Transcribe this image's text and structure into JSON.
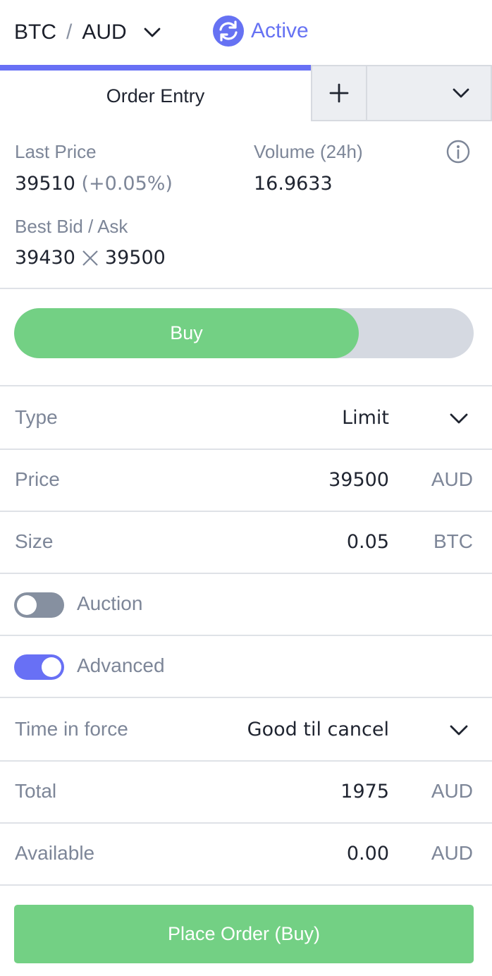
{
  "header": {
    "base": "BTC",
    "separator": "/",
    "quote": "AUD",
    "status": "Active",
    "icons": {
      "pair_dropdown": "chevron-down-icon",
      "status": "sync-icon"
    }
  },
  "tabs": {
    "active_label": "Order Entry",
    "add_icon": "plus-icon",
    "more_icon": "chevron-down-icon"
  },
  "stats": {
    "last_price_label": "Last Price",
    "last_price": "39510",
    "last_change": "(+0.05%)",
    "volume_label": "Volume (24h)",
    "volume": "16.9633",
    "best_bid_ask_label": "Best Bid / Ask",
    "best_bid": "39430",
    "best_ask": "39500",
    "info_icon": "info-icon"
  },
  "side": {
    "selected": "Buy"
  },
  "form": {
    "type": {
      "label": "Type",
      "value": "Limit"
    },
    "price": {
      "label": "Price",
      "value": "39500",
      "unit": "AUD"
    },
    "size": {
      "label": "Size",
      "value": "0.05",
      "unit": "BTC"
    },
    "auction": {
      "label": "Auction",
      "enabled": false
    },
    "advanced": {
      "label": "Advanced",
      "enabled": true
    },
    "time_in_force": {
      "label": "Time in force",
      "value": "Good til cancel"
    },
    "total": {
      "label": "Total",
      "value": "1975",
      "unit": "AUD"
    },
    "available": {
      "label": "Available",
      "value": "0.00",
      "unit": "AUD"
    }
  },
  "actions": {
    "place_order": "Place Order (Buy)"
  },
  "colors": {
    "accent": "#6870f5",
    "buy": "#73d084",
    "label": "#7d8698",
    "divider": "#dfe2e7"
  }
}
